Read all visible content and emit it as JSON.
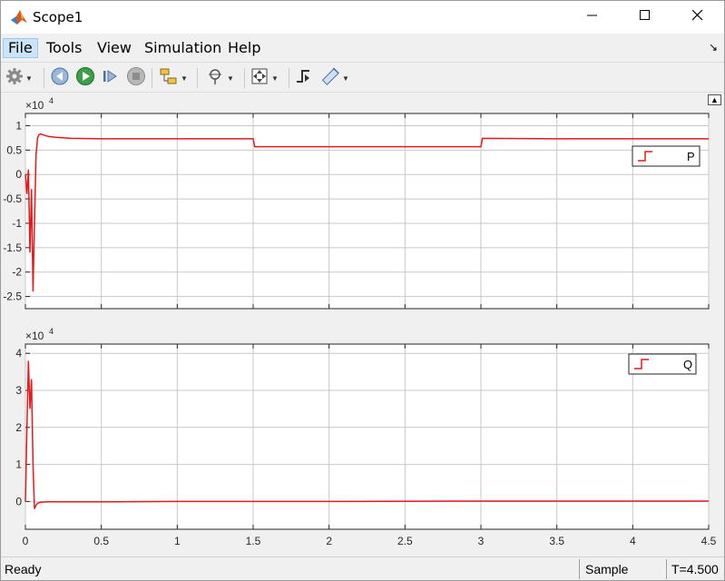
{
  "window": {
    "title": "Scope1",
    "icons": {
      "app": "matlab-logo-icon",
      "minimize": "minimize-icon",
      "maximize": "maximize-icon",
      "close": "close-icon"
    }
  },
  "menubar": {
    "items": [
      {
        "label": "File",
        "active": true
      },
      {
        "label": "Tools"
      },
      {
        "label": "View"
      },
      {
        "label": "Simulation"
      },
      {
        "label": "Help"
      }
    ],
    "dock_icon": "dock-arrow-icon"
  },
  "toolbar": {
    "items": [
      {
        "name": "configuration-gear-icon",
        "dropdown": true
      },
      {
        "name": "step-back-icon"
      },
      {
        "name": "run-icon"
      },
      {
        "name": "step-forward-icon"
      },
      {
        "name": "stop-icon"
      },
      {
        "name": "highlight-simulink-block-icon",
        "dropdown": true
      },
      {
        "name": "zoom-icon",
        "dropdown": true
      },
      {
        "name": "scale-axes-icon",
        "dropdown": true
      },
      {
        "name": "triggers-icon"
      },
      {
        "name": "cursor-measurements-icon",
        "dropdown": true
      }
    ]
  },
  "colors": {
    "trace": "#e41a1c",
    "grid": "#c8c8c8",
    "axes_bg": "#ffffff"
  },
  "chart_data": [
    {
      "type": "line",
      "exponent_label": "×10",
      "exponent_power": "4",
      "yticks": [
        1,
        0.5,
        0,
        -0.5,
        -1,
        -1.5,
        -2,
        -2.5
      ],
      "ytick_labels": [
        "1",
        "0.5",
        "0",
        "-0.5",
        "-1",
        "-1.5",
        "-2",
        "-2.5"
      ],
      "ylim": [
        -2.75,
        1.25
      ],
      "xlim": [
        0,
        4.5
      ],
      "grid": true,
      "legend_placement": "top-right",
      "series": [
        {
          "name": "P",
          "x": [
            0,
            0.01,
            0.02,
            0.03,
            0.04,
            0.05,
            0.06,
            0.07,
            0.08,
            0.09,
            0.1,
            0.12,
            0.15,
            0.2,
            0.3,
            0.5,
            1.0,
            1.5,
            1.51,
            2.0,
            2.5,
            3.0,
            3.01,
            3.5,
            4.0,
            4.5
          ],
          "y": [
            0,
            -0.4,
            0.1,
            -1.6,
            -0.3,
            -2.4,
            -1.0,
            0.4,
            0.75,
            0.82,
            0.83,
            0.81,
            0.78,
            0.76,
            0.74,
            0.73,
            0.73,
            0.73,
            0.57,
            0.57,
            0.57,
            0.57,
            0.74,
            0.73,
            0.73,
            0.73
          ]
        }
      ]
    },
    {
      "type": "line",
      "exponent_label": "×10",
      "exponent_power": "4",
      "yticks": [
        4,
        3,
        2,
        1,
        0
      ],
      "ytick_labels": [
        "4",
        "3",
        "2",
        "1",
        "0"
      ],
      "ylim": [
        -0.75,
        4.25
      ],
      "xlim": [
        0,
        4.5
      ],
      "xticks": [
        0,
        0.5,
        1,
        1.5,
        2,
        2.5,
        3,
        3.5,
        4,
        4.5
      ],
      "xtick_labels": [
        "0",
        "0.5",
        "1",
        "1.5",
        "2",
        "2.5",
        "3",
        "3.5",
        "4",
        "4.5"
      ],
      "grid": true,
      "legend_placement": "top-right",
      "series": [
        {
          "name": "Q",
          "x": [
            0,
            0.01,
            0.02,
            0.03,
            0.04,
            0.05,
            0.06,
            0.07,
            0.08,
            0.1,
            0.15,
            0.5,
            1.0,
            2.0,
            3.0,
            4.0,
            4.5
          ],
          "y": [
            0,
            2.0,
            3.8,
            2.5,
            3.3,
            1.0,
            -0.2,
            -0.1,
            -0.05,
            -0.02,
            -0.01,
            -0.01,
            0.0,
            0.0,
            0.01,
            0.01,
            0.01
          ]
        }
      ]
    }
  ],
  "statusbar": {
    "status": "Ready",
    "mode": "Sample based",
    "time": "T=4.500"
  }
}
